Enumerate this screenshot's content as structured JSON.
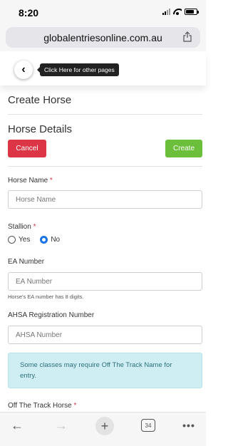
{
  "status_bar": {
    "time": "8:20"
  },
  "browser": {
    "url": "globalentriesonline.com.au"
  },
  "page_header": {
    "back_icon": "chevron-left",
    "tooltip": "Click Here for other pages"
  },
  "form": {
    "page_title": "Create Horse",
    "section_title": "Horse Details",
    "cancel_label": "Cancel",
    "create_label": "Create",
    "horse_name": {
      "label": "Horse Name",
      "required": "*",
      "placeholder": "Horse Name",
      "value": ""
    },
    "stallion": {
      "label": "Stallion",
      "required": "*",
      "options": [
        "Yes",
        "No"
      ],
      "selected": "No"
    },
    "ea_number": {
      "label": "EA Number",
      "placeholder": "EA Number",
      "value": "",
      "help": "Horse's EA number has 8 digits."
    },
    "ahsa_number": {
      "label": "AHSA Registration Number",
      "placeholder": "AHSA Number",
      "value": ""
    },
    "alert": "Some classes may require Off The Track Name for entry.",
    "off_track": {
      "label": "Off The Track Horse",
      "required": "*"
    }
  },
  "toolbar": {
    "tab_count": "34",
    "back_icon": "←",
    "forward_icon": "→",
    "new_tab_icon": "+",
    "more_icon": "•••"
  },
  "colors": {
    "cancel": "#dc3545",
    "create": "#6bbf3b",
    "radio_selected": "#1a73e8",
    "alert_bg": "#cfeef3",
    "alert_text": "#2f6f7c"
  }
}
